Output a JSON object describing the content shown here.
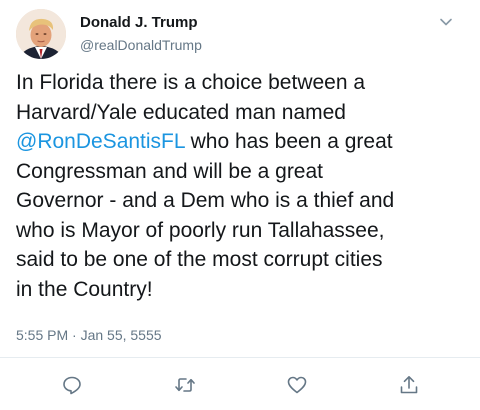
{
  "tweet": {
    "author": {
      "display_name": "Donald J. Trump",
      "handle": "@realDonaldTrump"
    },
    "text": {
      "line1": "In Florida there is a choice between a",
      "line2": "Harvard/Yale educated man named",
      "mention": "@RonDeSantisFL",
      "line3_rest": " who has been a great",
      "line4": "Congressman and will be a great",
      "line5": "Governor - and a Dem who is a thief and",
      "line6": "who is Mayor of poorly run Tallahassee,",
      "line7": "said to be one of the most corrupt cities",
      "line8": "in the Country!"
    },
    "timestamp": "5:55 PM · Jan 55, 5555"
  },
  "icons": {
    "caret": "chevron-down-icon",
    "reply": "reply-icon",
    "retweet": "retweet-icon",
    "like": "heart-icon",
    "share": "share-icon"
  },
  "colors": {
    "link": "#1b95e0",
    "secondary_text": "#657786",
    "primary_text": "#14171a"
  }
}
